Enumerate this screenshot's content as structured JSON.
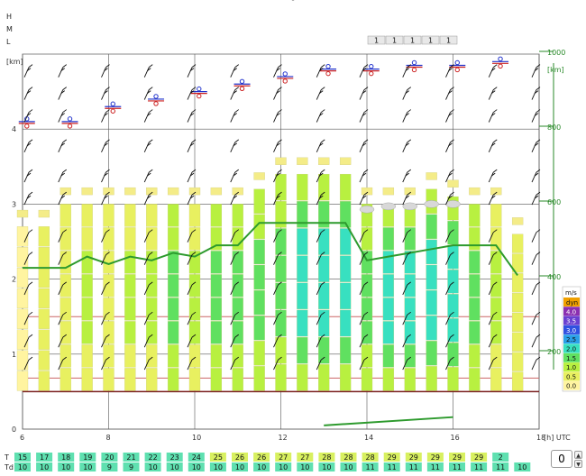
{
  "colors": {
    "grid": "#d9d9d9",
    "frame": "#888888",
    "boundary_line": "#2d9a2d",
    "inversion_dark": "#7a1f1f",
    "inversion_light": "#cc6666",
    "axis_right": "#2a8a2a"
  },
  "cloud_levels": [
    "H",
    "M",
    "L"
  ],
  "cloud_cover_counts": [
    "1",
    "1",
    "1",
    "1",
    "1"
  ],
  "spinner": {
    "value": "0",
    "up": "▲",
    "down": "▼"
  },
  "grip": "⌃",
  "chart_data": {
    "type": "heatmap",
    "title": "",
    "x_hours": [
      6,
      8,
      10,
      12,
      14,
      16,
      18
    ],
    "x_tick_labels": [
      "6",
      "8",
      "10",
      "12",
      "14",
      "16",
      "18"
    ],
    "x_unit_label": "[h] UTC",
    "y_unit_label": "[km]",
    "y_ticks_km": [
      "0",
      "1",
      "2",
      "3",
      "4"
    ],
    "ylim_km": [
      0,
      5
    ],
    "y_right_label": "[km]",
    "y_right_ticks": [
      "200",
      "400",
      "600",
      "800",
      "1000"
    ],
    "legend": {
      "title": "m/s",
      "entries": [
        {
          "label": "dyn",
          "color": "#f0a000"
        },
        {
          "label": "4.0",
          "color": "#8b2fb0"
        },
        {
          "label": "3.5",
          "color": "#6a3fd0"
        },
        {
          "label": "3.0",
          "color": "#3050e0"
        },
        {
          "label": "2.5",
          "color": "#2aa0e8"
        },
        {
          "label": "2.0",
          "color": "#38e0c0"
        },
        {
          "label": "1.5",
          "color": "#60e060"
        },
        {
          "label": "1.0",
          "color": "#b8f040"
        },
        {
          "label": "0.5",
          "color": "#e8f060"
        },
        {
          "label": "0.0",
          "color": "#fff4a0"
        }
      ]
    },
    "hours": [
      6.0,
      6.5,
      7.0,
      7.5,
      8.0,
      8.5,
      9.0,
      9.5,
      10.0,
      10.5,
      11.0,
      11.5,
      12.0,
      12.5,
      13.0,
      13.5,
      14.0,
      14.5,
      15.0,
      15.5,
      16.0,
      16.5,
      17.0,
      17.5
    ],
    "thermal_top_km": [
      2.7,
      2.7,
      3.0,
      3.0,
      3.0,
      3.0,
      3.0,
      3.0,
      3.0,
      3.0,
      3.0,
      3.2,
      3.4,
      3.4,
      3.4,
      3.4,
      3.0,
      3.0,
      3.0,
      3.2,
      3.1,
      3.0,
      3.0,
      2.6
    ],
    "max_updraft_ms": [
      0.0,
      0.5,
      0.5,
      1.0,
      0.5,
      1.0,
      1.0,
      1.5,
      1.0,
      1.5,
      1.5,
      1.5,
      1.5,
      2.0,
      2.0,
      2.0,
      1.5,
      2.0,
      2.0,
      2.0,
      2.0,
      1.5,
      1.0,
      0.5
    ],
    "boundary_layer_km": [
      2.15,
      2.15,
      2.15,
      2.3,
      2.2,
      2.3,
      2.25,
      2.35,
      2.3,
      2.45,
      2.45,
      2.75,
      2.75,
      2.75,
      2.75,
      2.75,
      2.25,
      2.3,
      2.35,
      2.4,
      2.45,
      2.45,
      2.45,
      2.05
    ],
    "cloud_base_km": [
      null,
      null,
      null,
      null,
      null,
      null,
      null,
      null,
      null,
      null,
      null,
      null,
      null,
      null,
      null,
      null,
      2.93,
      2.97,
      2.97,
      3.0,
      3.0,
      null,
      null,
      null
    ],
    "freezing_level_km": [
      4.1,
      4.1,
      4.1,
      4.2,
      4.3,
      4.4,
      4.4,
      4.4,
      4.5,
      4.6,
      4.6,
      4.7,
      4.7,
      4.75,
      4.8,
      4.85,
      4.8,
      4.8,
      4.85,
      4.85,
      4.85,
      4.9,
      4.9,
      4.9
    ],
    "temperature_2m_C": [
      "15",
      "17",
      "18",
      "19",
      "20",
      "21",
      "22",
      "23",
      "24",
      "25",
      "26",
      "26",
      "27",
      "27",
      "28",
      "28",
      "28",
      "29",
      "29",
      "29",
      "29",
      "29",
      "2"
    ],
    "dewpoint_2m_C": [
      "10",
      "10",
      "10",
      "10",
      "9",
      "9",
      "10",
      "10",
      "10",
      "10",
      "10",
      "10",
      "10",
      "10",
      "10",
      "10",
      "11",
      "11",
      "11",
      "11",
      "11",
      "11",
      "11",
      "10"
    ],
    "row_labels": {
      "temperature": "T",
      "dewpoint": "Td"
    }
  }
}
